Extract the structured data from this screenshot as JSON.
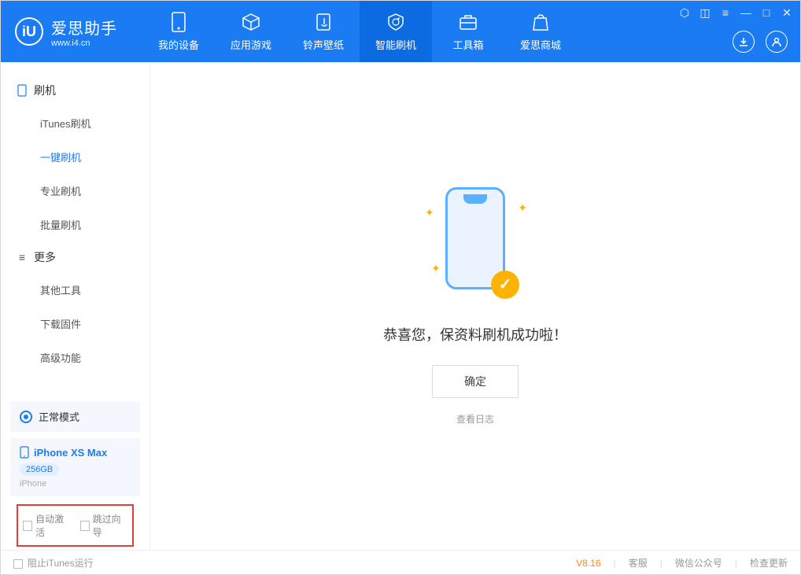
{
  "brand": {
    "name": "爱思助手",
    "url": "www.i4.cn"
  },
  "nav": {
    "items": [
      {
        "label": "我的设备"
      },
      {
        "label": "应用游戏"
      },
      {
        "label": "铃声壁纸"
      },
      {
        "label": "智能刷机"
      },
      {
        "label": "工具箱"
      },
      {
        "label": "爱思商城"
      }
    ]
  },
  "sidebar": {
    "section1_title": "刷机",
    "section1_items": [
      "iTunes刷机",
      "一键刷机",
      "专业刷机",
      "批量刷机"
    ],
    "section2_title": "更多",
    "section2_items": [
      "其他工具",
      "下载固件",
      "高级功能"
    ],
    "mode_label": "正常模式",
    "device": {
      "name": "iPhone XS Max",
      "storage": "256GB",
      "type": "iPhone"
    },
    "checkbox1": "自动激活",
    "checkbox2": "跳过向导"
  },
  "main": {
    "success_msg": "恭喜您，保资料刷机成功啦！",
    "ok_button": "确定",
    "log_link": "查看日志"
  },
  "footer": {
    "block_itunes": "阻止iTunes运行",
    "version": "V8.16",
    "links": [
      "客服",
      "微信公众号",
      "检查更新"
    ]
  }
}
